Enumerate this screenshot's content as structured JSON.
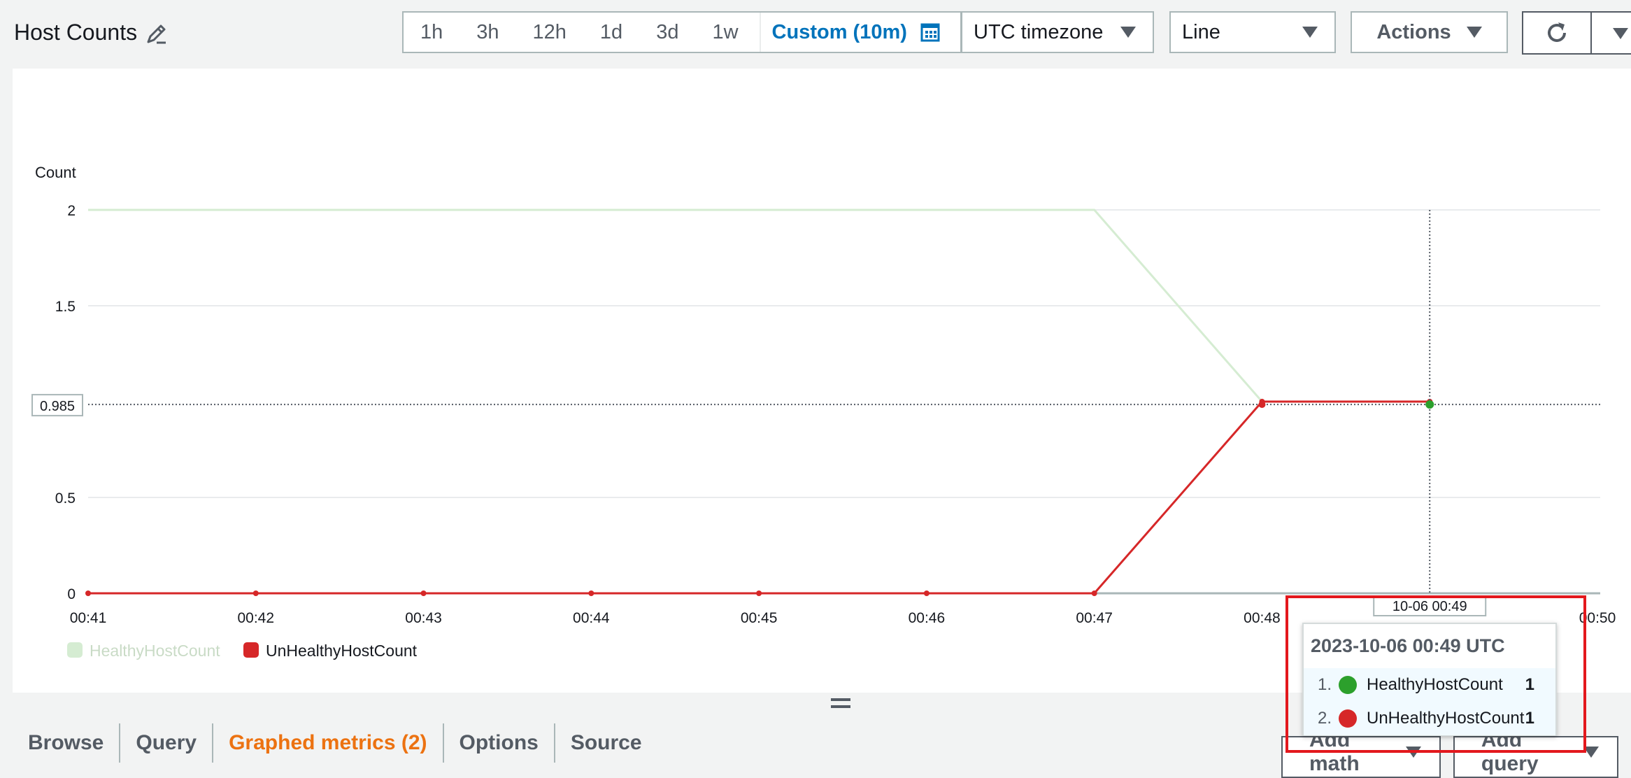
{
  "header": {
    "title": "Host Counts",
    "time_ranges": [
      "1h",
      "3h",
      "12h",
      "1d",
      "3d",
      "1w"
    ],
    "custom_range": "Custom (10m)",
    "timezone": "UTC timezone",
    "visualization": "Line",
    "actions_label": "Actions"
  },
  "chart_data": {
    "type": "line",
    "ylabel": "Count",
    "x": [
      "00:41",
      "00:42",
      "00:43",
      "00:44",
      "00:45",
      "00:46",
      "00:47",
      "00:48",
      "00:49"
    ],
    "x_ticks": [
      "00:41",
      "00:42",
      "00:43",
      "00:44",
      "00:45",
      "00:46",
      "00:47",
      "00:48",
      "00:49",
      "00:50"
    ],
    "y_ticks": [
      0,
      0.5,
      1.5,
      2
    ],
    "ylim": [
      0,
      2
    ],
    "series": [
      {
        "name": "HealthyHostCount",
        "color": "#d5ecd2",
        "values": [
          2,
          2,
          2,
          2,
          2,
          2,
          2,
          1,
          1
        ]
      },
      {
        "name": "UnHealthyHostCount",
        "color": "#d62728",
        "values": [
          0,
          0,
          0,
          0,
          0,
          0,
          0,
          1,
          1
        ]
      }
    ],
    "crosshair": {
      "y_value": 0.985,
      "y_label": "0.985",
      "x_label": "10-06 00:49"
    },
    "legend": "bottom-left"
  },
  "tooltip": {
    "time": "2023-10-06 00:49 UTC",
    "rows": [
      {
        "index": "1.",
        "name": "HealthyHostCount",
        "value": "1",
        "color": "#2ca02c"
      },
      {
        "index": "2.",
        "name": "UnHealthyHostCount",
        "value": "1",
        "color": "#d62728"
      }
    ]
  },
  "bottom": {
    "tabs": [
      "Browse",
      "Query",
      "Graphed metrics (2)",
      "Options",
      "Source"
    ],
    "add_math": "Add math",
    "add_query": "Add query"
  }
}
